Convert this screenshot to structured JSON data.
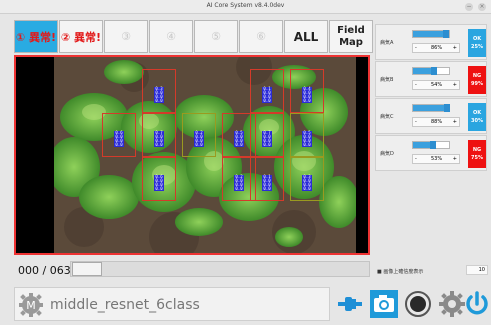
{
  "window": {
    "title": "AI Core System v8.4.0dev",
    "min_icon": "−",
    "close_icon": "×"
  },
  "tabs": [
    {
      "label": "① 異常!",
      "state": "selected-alert"
    },
    {
      "label": "② 異常!",
      "state": "alert"
    },
    {
      "label": "③",
      "state": "disabled"
    },
    {
      "label": "④",
      "state": "disabled"
    },
    {
      "label": "⑤",
      "state": "disabled"
    },
    {
      "label": "⑥",
      "state": "disabled"
    },
    {
      "label": "ALL",
      "state": "normal"
    },
    {
      "label": "Field Map",
      "state": "normal"
    }
  ],
  "detections": [
    {
      "text": [
        "0.3",
        "0.0",
        "0.0",
        "0.0"
      ],
      "color": "#d43a2a"
    },
    {
      "text": [
        "0.6",
        "0.0",
        "0.0",
        "0.0"
      ],
      "color": "#d43a2a"
    },
    {
      "text": [
        "0.7",
        "0.0",
        "0.0",
        "0.0"
      ],
      "color": "#d43a2a"
    },
    {
      "text": [
        "0.2",
        "0.0",
        "0.0",
        "0.0"
      ],
      "color": "#d43a2a"
    },
    {
      "text": [
        "0.5",
        "0.0",
        "0.0",
        "0.0"
      ],
      "color": "#d43a2a"
    },
    {
      "text": [
        "0.1",
        "0.0",
        "0.0",
        "0.0"
      ],
      "color": "#d43a2a"
    },
    {
      "text": [
        "0.4",
        "0.0",
        "0.0",
        "0.0"
      ],
      "color": "#9a9a20"
    }
  ],
  "playback": {
    "counter": "000 / 063"
  },
  "model": {
    "name": "middle_resnet_6class"
  },
  "toolbar_icons": [
    "gear-m-icon",
    "connector-icon",
    "camera-icon",
    "record-icon",
    "gear-icon",
    "power-icon"
  ],
  "classes": [
    {
      "name": "病気A",
      "percent": "86%",
      "value": 0.86,
      "status": "OK",
      "score": "25%",
      "status_color": "#2aa5e0"
    },
    {
      "name": "病気B",
      "percent": "54%",
      "value": 0.54,
      "status": "NG",
      "score": "99%",
      "status_color": "#ee1111"
    },
    {
      "name": "病気C",
      "percent": "88%",
      "value": 0.88,
      "status": "OK",
      "score": "30%",
      "status_color": "#2aa5e0"
    },
    {
      "name": "病気D",
      "percent": "53%",
      "value": 0.53,
      "status": "NG",
      "score": "75%",
      "status_color": "#ee1111"
    }
  ],
  "stepper": {
    "minus": "-",
    "plus": "+"
  },
  "option": {
    "label": "■ 画像上確信度表示"
  },
  "numfield": {
    "value": "10"
  }
}
